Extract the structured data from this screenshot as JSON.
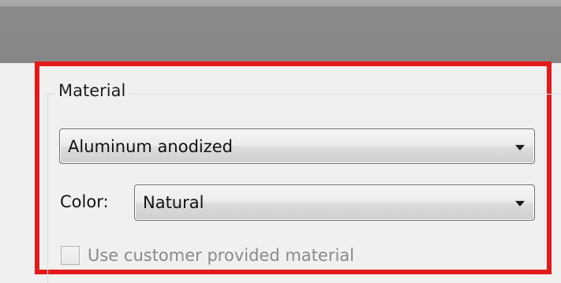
{
  "material_group": {
    "title": "Material",
    "material_select": {
      "value": "Aluminum anodized"
    },
    "color_label": "Color:",
    "color_select": {
      "value": "Natural"
    },
    "customer_material": {
      "label": "Use customer provided material",
      "checked": false,
      "enabled": false
    }
  },
  "highlight_color": "#e41a1a",
  "icons": {
    "dropdown": "chevron-down-icon"
  }
}
